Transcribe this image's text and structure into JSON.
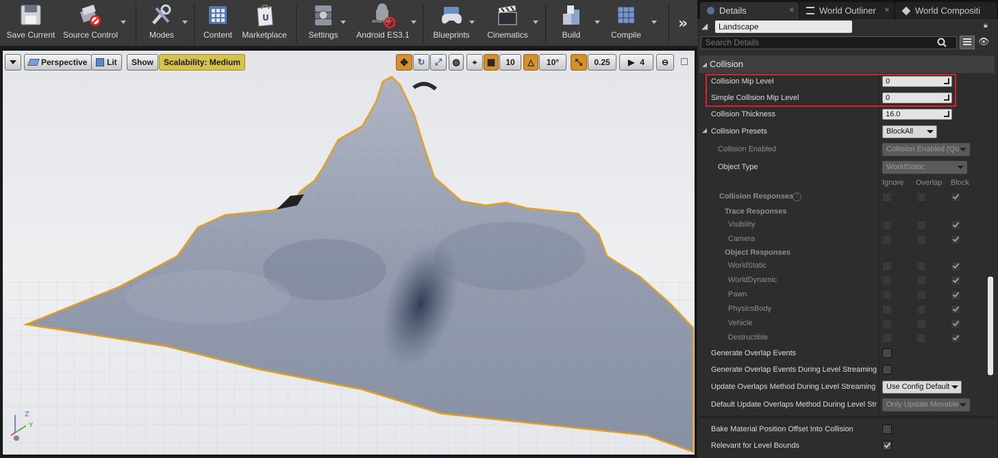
{
  "toolbar": {
    "buttons": [
      {
        "label": "Save Current",
        "icon": "save-disk-icon"
      },
      {
        "label": "Source Control",
        "icon": "source-control-disabled-icon"
      },
      {
        "label": "Modes",
        "icon": "modes-tools-icon"
      },
      {
        "label": "Content",
        "icon": "content-grid-icon"
      },
      {
        "label": "Marketplace",
        "icon": "marketplace-bag-icon"
      },
      {
        "label": "Settings",
        "icon": "settings-gears-icon"
      },
      {
        "label": "Android ES3.1",
        "icon": "android-icon"
      },
      {
        "label": "Blueprints",
        "icon": "blueprints-gamepad-icon"
      },
      {
        "label": "Cinematics",
        "icon": "clapperboard-icon"
      },
      {
        "label": "Build",
        "icon": "build-blocks-icon"
      },
      {
        "label": "Compile",
        "icon": "compile-cubes-icon"
      }
    ],
    "more": "»"
  },
  "viewport": {
    "perspective": "Perspective",
    "lit": "Lit",
    "show": "Show",
    "scalability": "Scalability: Medium",
    "grid_snap": "10",
    "rotation_snap": "10°",
    "scale_snap": "0.25",
    "camera_speed": "4",
    "axis_z": "Z",
    "axis_y": "Y",
    "colors": {
      "selection": "#e7a21c",
      "terrain": "#8f97a9"
    }
  },
  "panel": {
    "tabs": [
      {
        "label": "Details",
        "icon": "details-icon"
      },
      {
        "label": "World Outliner",
        "icon": "outliner-icon"
      },
      {
        "label": "World Compositi",
        "icon": "world-composition-icon"
      }
    ],
    "actor_name": "Landscape",
    "search_placeholder": "Search Details",
    "category": "Collision",
    "props": {
      "collision_mip_level": {
        "label": "Collision Mip Level",
        "value": "0"
      },
      "simple_collision_mip_level": {
        "label": "Simple Collision Mip Level",
        "value": "0"
      },
      "collision_thickness": {
        "label": "Collision Thickness",
        "value": "16.0"
      },
      "collision_presets": {
        "label": "Collision Presets",
        "value": "BlockAll"
      },
      "collision_enabled": {
        "label": "Collision Enabled",
        "value": "Collision Enabled (Qu"
      },
      "object_type": {
        "label": "Object Type",
        "value": "WorldStatic"
      }
    },
    "columns": {
      "ignore": "Ignore",
      "overlap": "Overlap",
      "block": "Block"
    },
    "responses": {
      "collision_responses": "Collision Responses",
      "trace_responses": "Trace Responses",
      "object_responses": "Object Responses",
      "trace": [
        "Visibility",
        "Camera"
      ],
      "object": [
        "WorldStatic",
        "WorldDynamic",
        "Pawn",
        "PhysicsBody",
        "Vehicle",
        "Destructible"
      ]
    },
    "extra": {
      "generate_overlap": "Generate Overlap Events",
      "generate_overlap_streaming": "Generate Overlap Events During Level Streaming",
      "update_overlaps_method": {
        "label": "Update Overlaps Method During Level Streaming",
        "value": "Use Config Default"
      },
      "default_update_overlaps": {
        "label": "Default Update Overlaps Method During Level Str",
        "value": "Only Update Movable"
      },
      "bake_material": "Bake Material Position Offset Into Collision",
      "relevant_level_bounds": "Relevant for Level Bounds"
    },
    "colors": {
      "highlight": "#e0212b"
    }
  }
}
